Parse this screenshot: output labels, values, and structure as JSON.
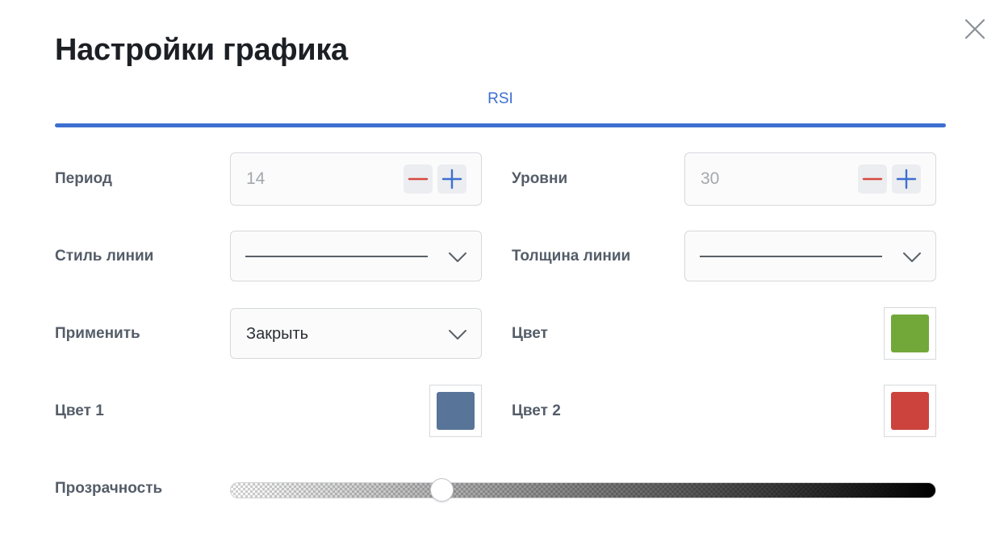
{
  "dialog": {
    "title": "Настройки графика",
    "close_icon": "close-icon"
  },
  "tabs": [
    {
      "label": "RSI",
      "active": true
    }
  ],
  "fields": {
    "period": {
      "label": "Период",
      "value": "14",
      "decrement_icon": "minus-icon",
      "increment_icon": "plus-icon"
    },
    "levels": {
      "label": "Уровни",
      "value": "30",
      "decrement_icon": "minus-icon",
      "increment_icon": "plus-icon"
    },
    "line_style": {
      "label": "Стиль линии",
      "selected": "solid",
      "dropdown_icon": "chevron-down-icon"
    },
    "line_width": {
      "label": "Толщина линии",
      "selected": "thin",
      "dropdown_icon": "chevron-down-icon"
    },
    "apply_to": {
      "label": "Применить",
      "selected": "Закрыть",
      "dropdown_icon": "chevron-down-icon"
    },
    "color": {
      "label": "Цвет",
      "value": "#72a83a"
    },
    "color1": {
      "label": "Цвет 1",
      "value": "#587498"
    },
    "color2": {
      "label": "Цвет 2",
      "value": "#cc433e"
    },
    "transparency": {
      "label": "Прозрачность",
      "value_fraction": 0.3
    }
  },
  "colors": {
    "accent": "#3d6fd1",
    "minus": "#d8483d",
    "plus": "#3d6fd1",
    "text_muted": "#545d69"
  }
}
